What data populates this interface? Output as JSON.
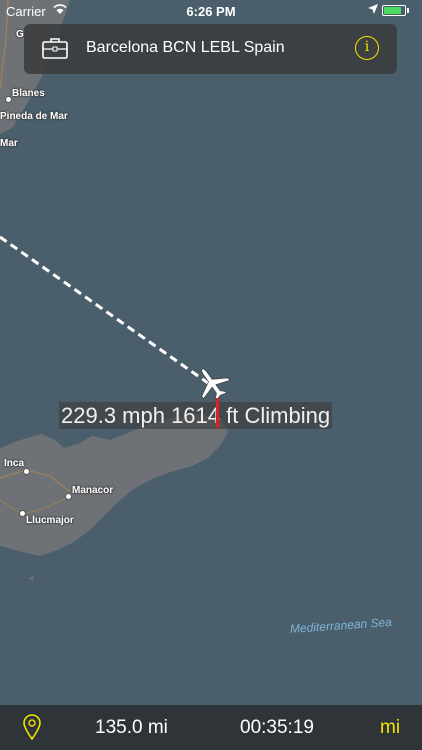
{
  "status_bar": {
    "carrier": "Carrier",
    "time": "6:26 PM",
    "battery_level": 0.85
  },
  "banner": {
    "title": "Barcelona BCN LEBL Spain",
    "info_glyph": "i",
    "icon": "briefcase-icon"
  },
  "map": {
    "places": {
      "cut_off": "G",
      "blanes": "Blanes",
      "pineda": "Pineda de Mar",
      "mar": "Mar",
      "inca": "Inca",
      "manacor": "Manacor",
      "llucmajor": "Llucmajor"
    },
    "sea_label": "Mediterranean Sea"
  },
  "flight": {
    "telemetry": "229.3 mph 1614 ft Climbing",
    "icon": "airplane-icon"
  },
  "bottom_bar": {
    "distance": "135.0 mi",
    "elapsed": "00:35:19",
    "unit": "mi",
    "icon": "location-pin-icon"
  },
  "colors": {
    "sea": "#4a5e6b",
    "land": "#6e7276",
    "accent_yellow": "#f2e500",
    "route": "#ffffff",
    "climb_indicator": "#e02020",
    "bar_background": "#2f3438"
  }
}
